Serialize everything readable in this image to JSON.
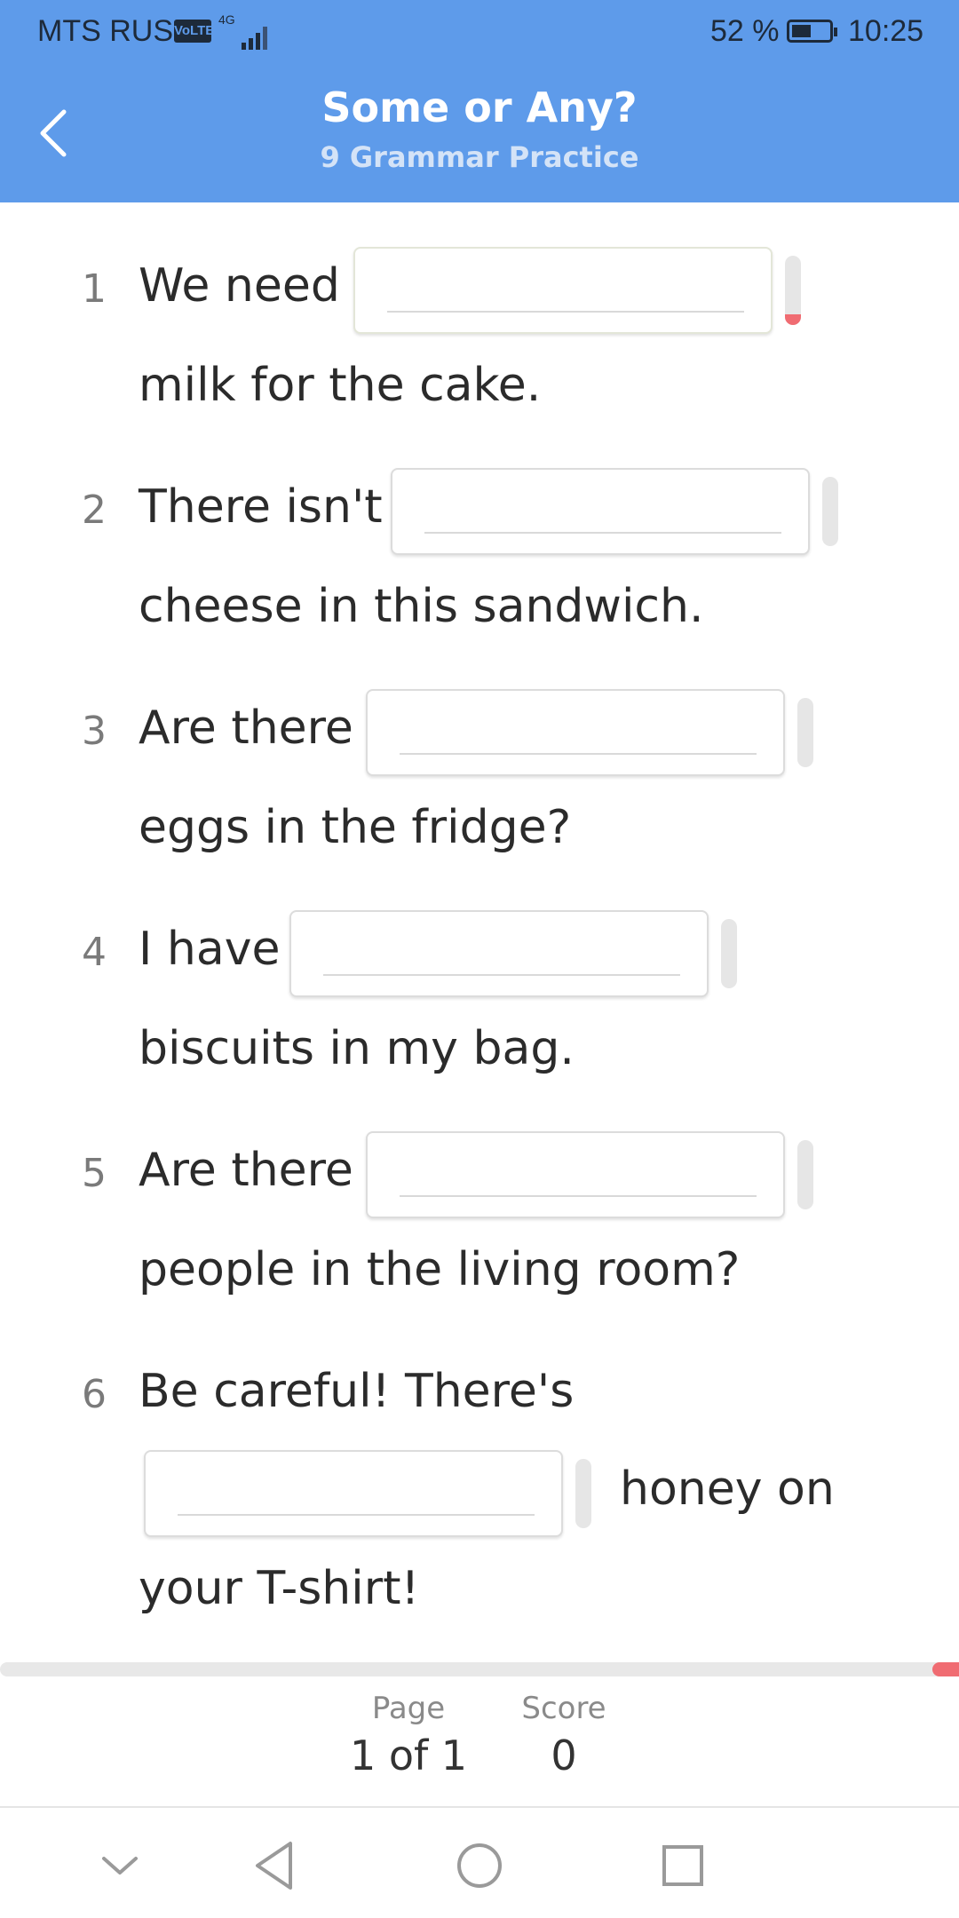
{
  "status_bar": {
    "carrier": "MTS RUS",
    "volte": "VoLTE",
    "network": "4G",
    "battery_percent": "52 %",
    "battery_level": 0.52,
    "time": "10:25"
  },
  "header": {
    "title": "Some or Any?",
    "subtitle": "9 Grammar Practice",
    "back_icon": "chevron-left-icon"
  },
  "questions": [
    {
      "number": "1",
      "before": "We need",
      "after": "milk for the cake.",
      "answer": ""
    },
    {
      "number": "2",
      "before": "There isn't",
      "after": "cheese in this sandwich.",
      "answer": ""
    },
    {
      "number": "3",
      "before": "Are there",
      "after": "eggs in the fridge?",
      "answer": ""
    },
    {
      "number": "4",
      "before": "I have",
      "after": "biscuits in my bag.",
      "answer": ""
    },
    {
      "number": "5",
      "before": "Are there",
      "after": "people in the living room?",
      "answer": ""
    },
    {
      "number": "6",
      "before": "Be careful! There's",
      "mid": "honey on",
      "after": "your T-shirt!",
      "answer": ""
    }
  ],
  "footer": {
    "page_label": "Page",
    "page_value": "1 of 1",
    "score_label": "Score",
    "score_value": "0"
  },
  "colors": {
    "header_bg": "#5e9bea",
    "error": "#f06c72"
  },
  "nav": {
    "icons": [
      "chevron-down-icon",
      "back-triangle-icon",
      "home-circle-icon",
      "recents-square-icon"
    ]
  }
}
